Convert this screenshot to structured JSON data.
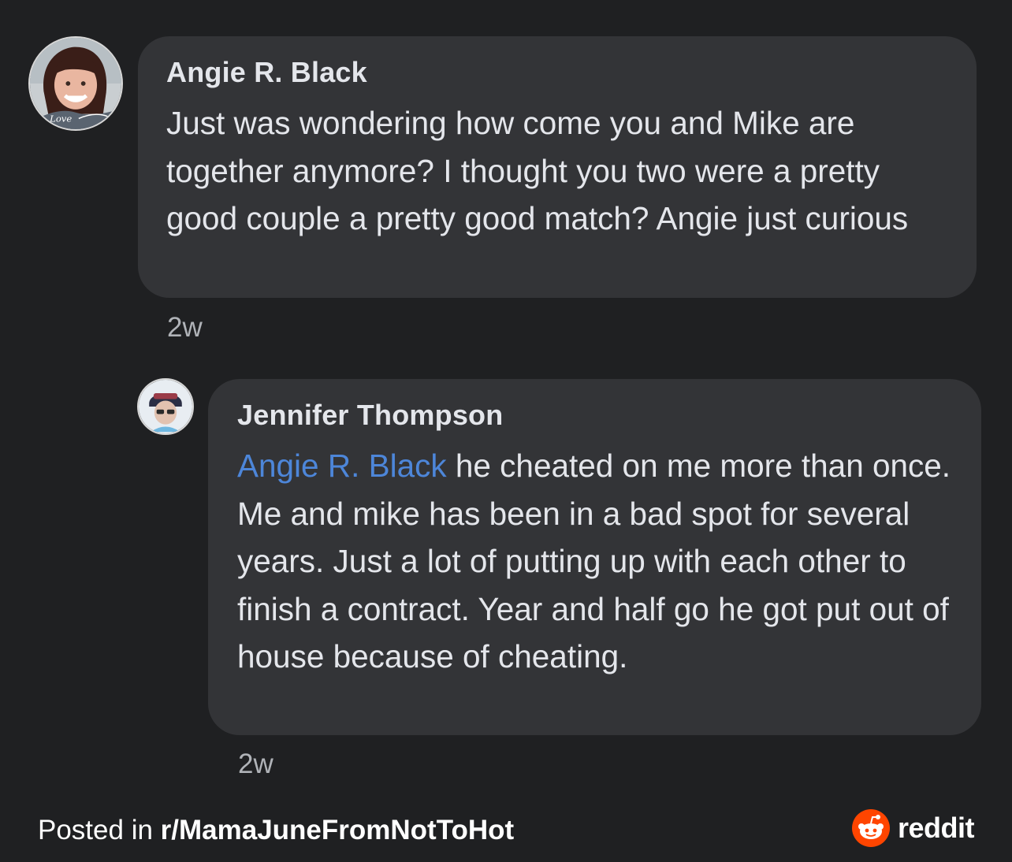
{
  "comments": [
    {
      "author": "Angie R. Black",
      "body": "Just was wondering how come you and Mike are together anymore? I thought you two were a pretty good couple a pretty good match? Angie just curious",
      "time": "2w",
      "avatar_icon": "profile-photo-icon",
      "avatar_script": "Love"
    },
    {
      "author": "Jennifer Thompson",
      "mention": "Angie R. Black",
      "body": " he cheated on me more than once. Me and mike has been in a bad spot for several years. Just a lot of putting up with each other to finish a contract. Year and half go he got put out of house because of cheating.",
      "time": "2w",
      "avatar_icon": "profile-photo-icon"
    }
  ],
  "footer": {
    "prefix": "Posted in ",
    "subreddit": "r/MamaJuneFromNotToHot",
    "brand": "reddit",
    "brand_icon": "reddit-snoo-icon"
  },
  "colors": {
    "background": "#1f2022",
    "bubble": "#333437",
    "mention": "#4d86d9",
    "reddit_orange": "#ff4500"
  }
}
